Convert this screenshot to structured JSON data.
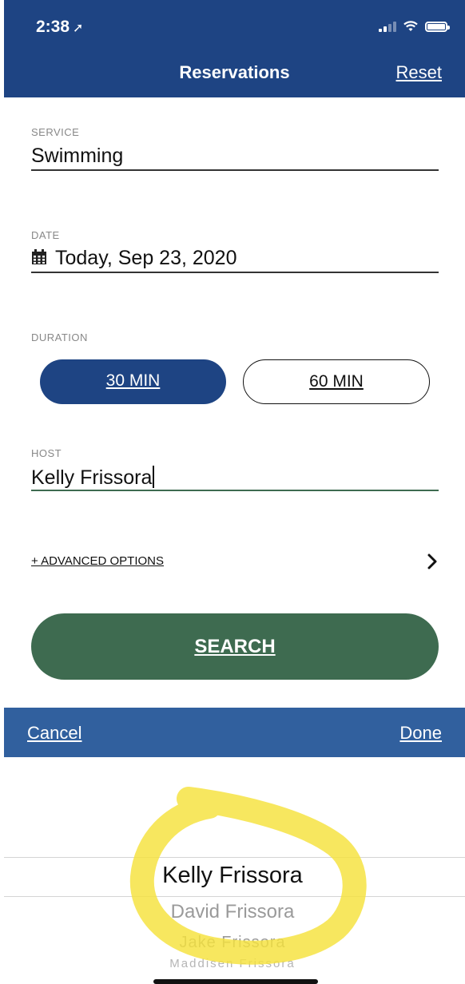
{
  "status_bar": {
    "time": "2:38",
    "location_icon": "location-arrow-icon",
    "icons": [
      "signal-icon",
      "wifi-icon",
      "battery-icon"
    ]
  },
  "header": {
    "title": "Reservations",
    "reset_label": "Reset"
  },
  "form": {
    "service": {
      "label": "SERVICE",
      "value": "Swimming"
    },
    "date": {
      "label": "DATE",
      "icon": "calendar-icon",
      "value": "Today, Sep 23, 2020"
    },
    "duration": {
      "label": "DURATION",
      "options": [
        "30 MIN",
        "60 MIN"
      ],
      "selected": "30 MIN"
    },
    "host": {
      "label": "HOST",
      "value": "Kelly Frissora"
    },
    "advanced_label": "+ ADVANCED OPTIONS",
    "search_label": "SEARCH"
  },
  "picker": {
    "cancel_label": "Cancel",
    "done_label": "Done",
    "options": [
      "Kelly Frissora",
      "David Frissora",
      "Jake Frissora",
      "Maddisen Frissora"
    ],
    "selected": "Kelly Frissora"
  },
  "colors": {
    "header": "#1e4483",
    "search": "#3e6b50",
    "toolbar": "#31609e",
    "highlight": "#f5e23c"
  }
}
